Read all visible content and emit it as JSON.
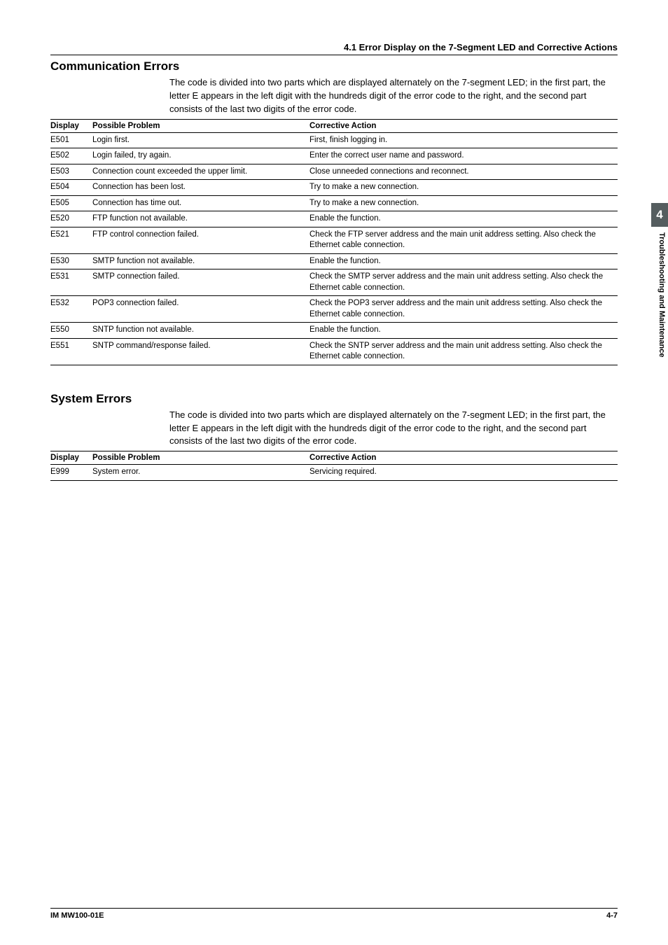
{
  "header": {
    "section_title": "4.1  Error Display on the 7-Segment LED and Corrective Actions"
  },
  "comm_errors": {
    "heading": "Communication Errors",
    "intro": "The code is divided into two parts which are displayed alternately on the 7-segment LED; in the first part, the letter E appears in the left digit with the hundreds digit of the error code to the right, and the second part consists of the last two digits of the error code.",
    "th_display": "Display",
    "th_problem": "Possible Problem",
    "th_action": "Corrective Action",
    "rows": [
      {
        "display": "E501",
        "problem": "Login first.",
        "action": "First, finish logging in."
      },
      {
        "display": "E502",
        "problem": "Login failed, try again.",
        "action": "Enter the correct user name and password."
      },
      {
        "display": "E503",
        "problem": "Connection count exceeded the upper limit.",
        "action": "Close unneeded connections and reconnect."
      },
      {
        "display": "E504",
        "problem": "Connection has been lost.",
        "action": "Try to make a new connection."
      },
      {
        "display": "E505",
        "problem": "Connection has time out.",
        "action": "Try to make a new connection."
      },
      {
        "display": "E520",
        "problem": "FTP function not available.",
        "action": "Enable the function."
      },
      {
        "display": "E521",
        "problem": "FTP control connection failed.",
        "action": "Check the FTP server address and the main unit address setting. Also check the Ethernet cable connection."
      },
      {
        "display": "E530",
        "problem": "SMTP function not available.",
        "action": "Enable the function."
      },
      {
        "display": "E531",
        "problem": "SMTP connection failed.",
        "action": "Check the SMTP server address and the main unit address setting. Also check the Ethernet cable connection."
      },
      {
        "display": "E532",
        "problem": "POP3 connection failed.",
        "action": "Check the POP3 server address and the main unit address setting. Also check the Ethernet cable connection."
      },
      {
        "display": "E550",
        "problem": "SNTP function not available.",
        "action": "Enable the function."
      },
      {
        "display": "E551",
        "problem": "SNTP command/response failed.",
        "action": "Check the SNTP server address and the main unit address setting. Also check the Ethernet cable connection."
      }
    ]
  },
  "system_errors": {
    "heading": "System Errors",
    "intro": "The code is divided into two parts which are displayed alternately on the 7-segment LED; in the first part, the letter E appears in the left digit with the hundreds digit of the error code to the right, and the second part consists of the last two digits of the error code.",
    "th_display": "Display",
    "th_problem": "Possible Problem",
    "th_action": "Corrective Action",
    "rows": [
      {
        "display": "E999",
        "problem": "System error.",
        "action": "Servicing required."
      }
    ]
  },
  "side": {
    "chapter_num": "4",
    "chapter_label": "Troubleshooting and Maintenance"
  },
  "footer": {
    "doc_id": "IM MW100-01E",
    "page_num": "4-7"
  }
}
